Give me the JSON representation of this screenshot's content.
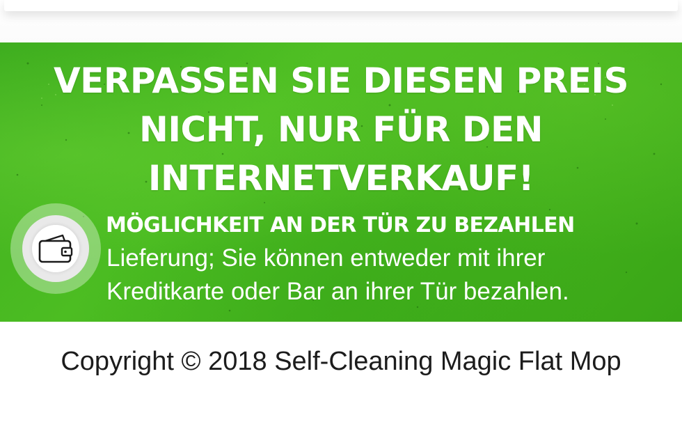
{
  "promo": {
    "headline_lines": [
      "VERPASSEN SIE DIESEN PREIS",
      "NICHT, NUR FÜR DEN",
      "INTERNETVERKAUF!"
    ],
    "feature": {
      "icon": "wallet-icon",
      "title": "MÖGLICHKEIT AN DER TÜR ZU BEZAHLEN",
      "description": "Lieferung; Sie können entweder mit ihrer Kreditkarte oder Bar an ihrer Tür bezahlen."
    },
    "background_color": "#45b41d"
  },
  "footer": {
    "copyright": "Copyright © 2018 Self-Cleaning Magic Flat Mop"
  }
}
